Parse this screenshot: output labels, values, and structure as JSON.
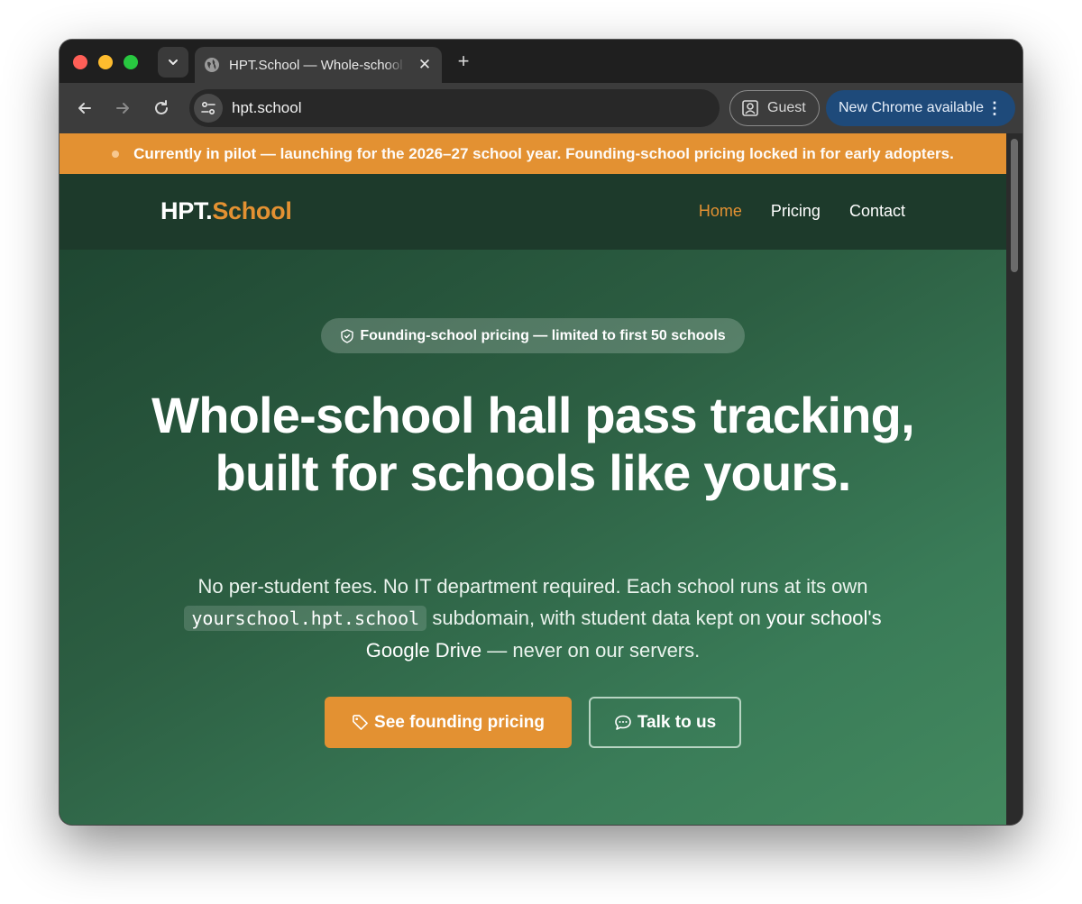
{
  "browser": {
    "tab_title": "HPT.School — Whole-school Hall Pass Tracking",
    "new_tab_label": "+",
    "url": "hpt.school",
    "profile_label": "Guest",
    "update_label": "New Chrome available",
    "close_glyph": "✕",
    "kebab_glyph": "⋮"
  },
  "banner": {
    "strong_text": "Currently in pilot",
    "rest_text": " — launching for the 2026–27 school year. Founding-school pricing locked in for early adopters."
  },
  "header": {
    "logo_part1": "HPT.",
    "logo_part2": "School",
    "nav": [
      {
        "label": "Home",
        "active": true
      },
      {
        "label": "Pricing",
        "active": false
      },
      {
        "label": "Contact",
        "active": false
      }
    ]
  },
  "hero": {
    "pill_text": "Founding-school pricing — limited to first 50 schools",
    "headline": "Whole-school hall pass tracking, built for schools like yours.",
    "sub_part1": "No per-student fees. No IT department required. Each school runs at its own ",
    "sub_code": "yourschool.hpt.school",
    "sub_part2": " subdomain, with student data kept on ",
    "sub_bold": "your school's Google Drive",
    "sub_part3": " — never on our servers.",
    "primary_button": "See founding pricing",
    "secondary_button": "Talk to us"
  },
  "colors": {
    "accent": "#e39132",
    "header_bg": "#1d3a2b",
    "hero_start": "#1f4732",
    "hero_end": "#43895f"
  }
}
